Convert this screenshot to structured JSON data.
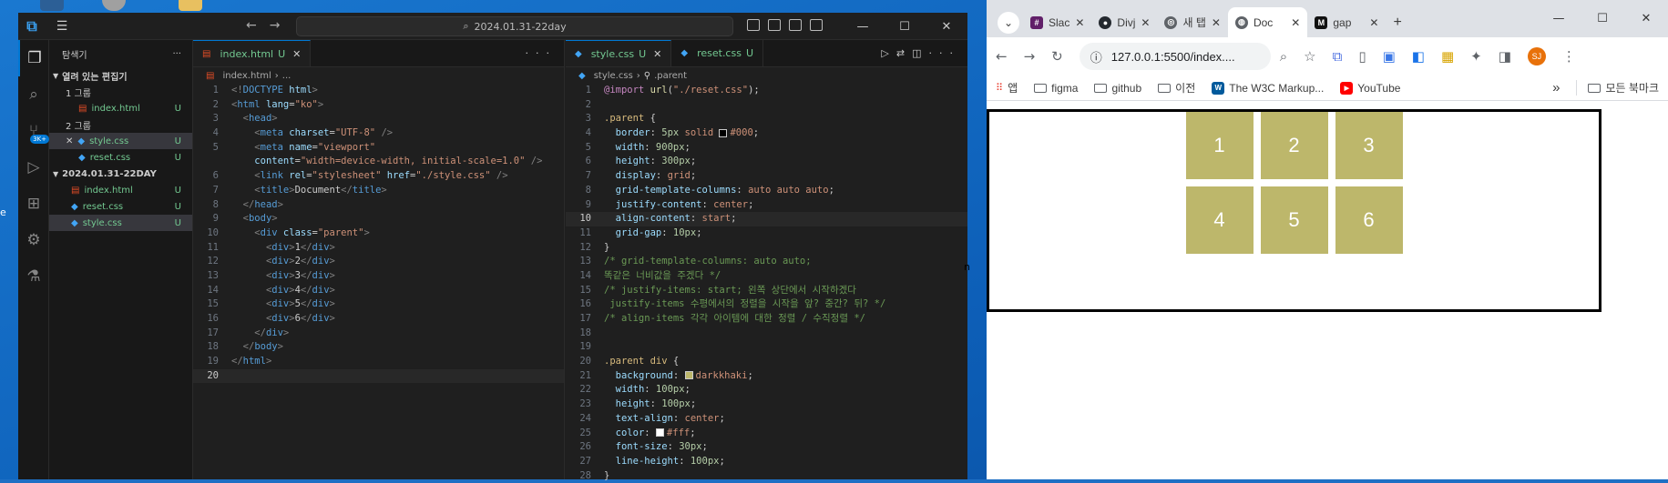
{
  "vscode": {
    "title_search": "2024.01.31-22day",
    "sidebar": {
      "header": "탐색기",
      "open_editors": "열려 있는 편집기",
      "group1": "1 그룹",
      "group2": "2 그룹",
      "files_g1": [
        {
          "name": "index.html",
          "status": "U"
        }
      ],
      "files_g2": [
        {
          "name": "style.css",
          "status": "U"
        },
        {
          "name": "reset.css",
          "status": "U"
        }
      ],
      "folder": "2024.01.31-22DAY",
      "folder_files": [
        {
          "name": "index.html",
          "status": "U"
        },
        {
          "name": "reset.css",
          "status": "U"
        },
        {
          "name": "style.css",
          "status": "U"
        }
      ],
      "badge": "3K+"
    },
    "editor1": {
      "tab": "index.html",
      "tab_status": "U",
      "breadcrumb_file": "index.html",
      "breadcrumb_rest": "...",
      "current_line": "20"
    },
    "editor2": {
      "tab_active": "style.css",
      "tab_active_status": "U",
      "tab_other": "reset.css",
      "tab_other_status": "U",
      "breadcrumb_file": "style.css",
      "breadcrumb_rest": ".parent",
      "current_line": "10"
    }
  },
  "browser": {
    "tabs": [
      {
        "label": "Slac",
        "color": "#611f69"
      },
      {
        "label": "Divj",
        "color": "#24292f"
      },
      {
        "label": "새 탭",
        "color": "#5f6368"
      },
      {
        "label": "Doc",
        "color": "#5f6368"
      },
      {
        "label": "gap",
        "color": "#111111"
      }
    ],
    "url": "127.0.0.1:5500/index....",
    "profile_initials": "SJ",
    "bookmarks": [
      "앱",
      "figma",
      "github",
      "이전",
      "The W3C Markup...",
      "YouTube"
    ],
    "bookmarks_more": "»",
    "all_bookmarks": "모든 북마크",
    "grid_items": [
      "1",
      "2",
      "3",
      "4",
      "5",
      "6"
    ]
  },
  "colors": {
    "darkkhaki": "#bdb76b",
    "vscode_bg": "#1f1f1f",
    "accent": "#0078d4"
  },
  "desktop": {
    "stray_char": "n",
    "left_edge_char": "e"
  }
}
